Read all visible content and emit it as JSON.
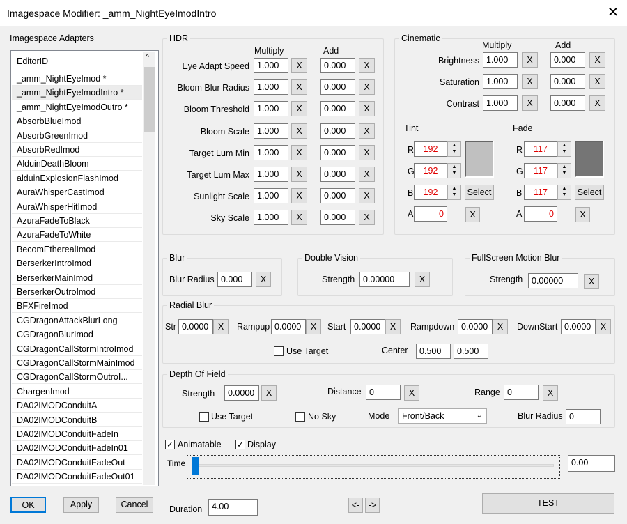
{
  "window": {
    "title": "Imagespace Modifier: _amm_NightEyeImodIntro",
    "close": "✕"
  },
  "adapters": {
    "label": "Imagespace Adapters",
    "header": "EditorID",
    "selected_index": 1,
    "items": [
      "_amm_NightEyeImod *",
      "_amm_NightEyeImodIntro *",
      "_amm_NightEyeImodOutro *",
      "AbsorbBlueImod",
      "AbsorbGreenImod",
      "AbsorbRedImod",
      "AlduinDeathBloom",
      "alduinExplosionFlashImod",
      "AuraWhisperCastImod",
      "AuraWhisperHitImod",
      "AzuraFadeToBlack",
      "AzuraFadeToWhite",
      "BecomEtherealImod",
      "BerserkerIntroImod",
      "BerserkerMainImod",
      "BerserkerOutroImod",
      "BFXFireImod",
      "CGDragonAttackBlurLong",
      "CGDragonBlurImod",
      "CGDragonCallStormIntroImod",
      "CGDragonCallStormMainImod",
      "CGDragonCallStormOutroI...",
      "ChargenImod",
      "DA02IMODConduitA",
      "DA02IMODConduitB",
      "DA02IMODConduitFadeIn",
      "DA02IMODConduitFadeIn01",
      "DA02IMODConduitFadeOut",
      "DA02IMODConduitFadeOut01"
    ],
    "scroll_up": "^"
  },
  "x": "X",
  "hdr": {
    "label": "HDR",
    "multiply": "Multiply",
    "add": "Add",
    "rows": [
      {
        "label": "Eye Adapt Speed",
        "mul": "1.000",
        "add": "0.000"
      },
      {
        "label": "Bloom Blur Radius",
        "mul": "1.000",
        "add": "0.000"
      },
      {
        "label": "Bloom Threshold",
        "mul": "1.000",
        "add": "0.000"
      },
      {
        "label": "Bloom Scale",
        "mul": "1.000",
        "add": "0.000"
      },
      {
        "label": "Target Lum Min",
        "mul": "1.000",
        "add": "0.000"
      },
      {
        "label": "Target Lum Max",
        "mul": "1.000",
        "add": "0.000"
      },
      {
        "label": "Sunlight Scale",
        "mul": "1.000",
        "add": "0.000"
      },
      {
        "label": "Sky Scale",
        "mul": "1.000",
        "add": "0.000"
      }
    ]
  },
  "cinematic": {
    "label": "Cinematic",
    "multiply": "Multiply",
    "add": "Add",
    "rows": [
      {
        "label": "Brightness",
        "mul": "1.000",
        "add": "0.000"
      },
      {
        "label": "Saturation",
        "mul": "1.000",
        "add": "0.000"
      },
      {
        "label": "Contrast",
        "mul": "1.000",
        "add": "0.000"
      }
    ],
    "tint": {
      "label": "Tint",
      "r": "192",
      "g": "192",
      "b": "192",
      "a": "0",
      "color": "#c0c0c0"
    },
    "fade": {
      "label": "Fade",
      "r": "117",
      "g": "117",
      "b": "117",
      "a": "0",
      "color": "#757575"
    },
    "r": "R",
    "g": "G",
    "b": "B",
    "alpha": "A",
    "select": "Select"
  },
  "blur": {
    "label": "Blur",
    "radius_label": "Blur Radius",
    "radius": "0.000"
  },
  "double_vision": {
    "label": "Double Vision",
    "strength_label": "Strength",
    "strength": "0.00000"
  },
  "motion_blur": {
    "label": "FullScreen Motion Blur",
    "strength_label": "Strength",
    "strength": "0.00000"
  },
  "radial": {
    "label": "Radial Blur",
    "str_label": "Str",
    "str": "0.0000",
    "rampup_label": "Rampup",
    "rampup": "0.0000",
    "start_label": "Start",
    "start": "0.0000",
    "rampdown_label": "Rampdown",
    "rampdown": "0.0000",
    "downstart_label": "DownStart",
    "downstart": "0.0000",
    "use_target": "Use Target",
    "center_label": "Center",
    "center_x": "0.500",
    "center_y": "0.500"
  },
  "dof": {
    "label": "Depth Of Field",
    "strength_label": "Strength",
    "strength": "0.0000",
    "distance_label": "Distance",
    "distance": "0",
    "range_label": "Range",
    "range": "0",
    "use_target": "Use Target",
    "no_sky": "No Sky",
    "mode_label": "Mode",
    "mode": "Front/Back",
    "blur_radius_label": "Blur Radius",
    "blur_radius": "0"
  },
  "anim": {
    "animatable": "Animatable",
    "animatable_checked": true,
    "display": "Display",
    "display_checked": true,
    "time_label": "Time",
    "time": "0.00",
    "time_slider": 0,
    "duration_label": "Duration",
    "duration": "4.00",
    "prev": "<-",
    "next": "->",
    "test": "TEST"
  },
  "footer": {
    "ok": "OK",
    "apply": "Apply",
    "cancel": "Cancel"
  }
}
